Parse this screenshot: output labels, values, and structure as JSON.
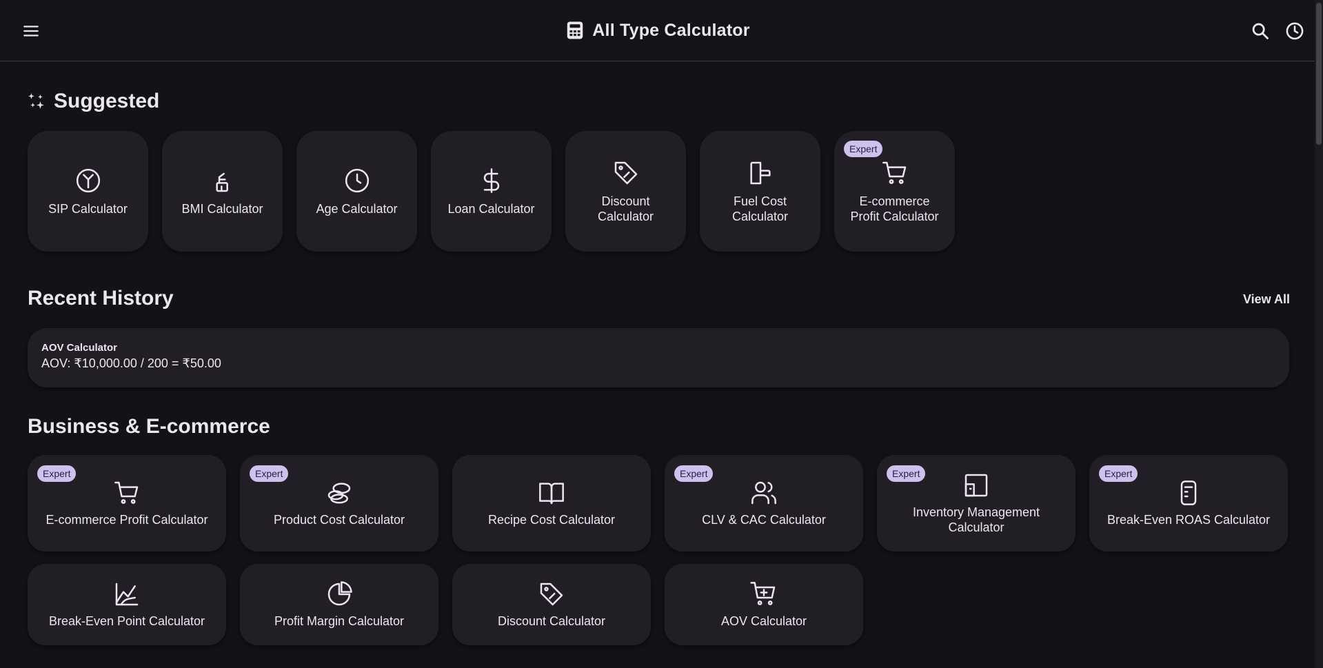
{
  "header": {
    "title": "All Type Calculator"
  },
  "suggested": {
    "title": "Suggested",
    "items": [
      {
        "label": "SIP Calculator",
        "icon": "sip-icon",
        "badge": ""
      },
      {
        "label": "BMI Calculator",
        "icon": "bmi-icon",
        "badge": ""
      },
      {
        "label": "Age Calculator",
        "icon": "clock-icon",
        "badge": ""
      },
      {
        "label": "Loan Calculator",
        "icon": "dollar-icon",
        "badge": ""
      },
      {
        "label": "Discount Calculator",
        "icon": "tag-icon",
        "badge": ""
      },
      {
        "label": "Fuel Cost Calculator",
        "icon": "fuel-icon",
        "badge": ""
      },
      {
        "label": "E-commerce Profit Calculator",
        "icon": "cart-icon",
        "badge": "Expert"
      }
    ]
  },
  "history": {
    "title": "Recent History",
    "view_all": "View All",
    "items": [
      {
        "name": "AOV Calculator",
        "result": "AOV: ₹10,000.00 / 200 = ₹50.00"
      }
    ]
  },
  "business": {
    "title": "Business & E-commerce",
    "items": [
      {
        "label": "E-commerce Profit Calculator",
        "icon": "cart-icon",
        "badge": "Expert"
      },
      {
        "label": "Product Cost Calculator",
        "icon": "coins-icon",
        "badge": "Expert"
      },
      {
        "label": "Recipe Cost Calculator",
        "icon": "book-icon",
        "badge": ""
      },
      {
        "label": "CLV & CAC Calculator",
        "icon": "users-icon",
        "badge": "Expert"
      },
      {
        "label": "Inventory Management Calculator",
        "icon": "inventory-icon",
        "badge": "Expert"
      },
      {
        "label": "Break-Even ROAS Calculator",
        "icon": "receipt-icon",
        "badge": "Expert"
      },
      {
        "label": "Break-Even Point Calculator",
        "icon": "chart-line-icon",
        "badge": ""
      },
      {
        "label": "Profit Margin Calculator",
        "icon": "pie-chart-icon",
        "badge": ""
      },
      {
        "label": "Discount Calculator",
        "icon": "tag-icon",
        "badge": ""
      },
      {
        "label": "AOV Calculator",
        "icon": "cart-plus-icon",
        "badge": ""
      }
    ]
  },
  "colors": {
    "background": "#131216",
    "card": "#211f25",
    "text": "#ece6f0",
    "badge_bg": "#cfc1ee",
    "badge_text": "#2a2140"
  }
}
